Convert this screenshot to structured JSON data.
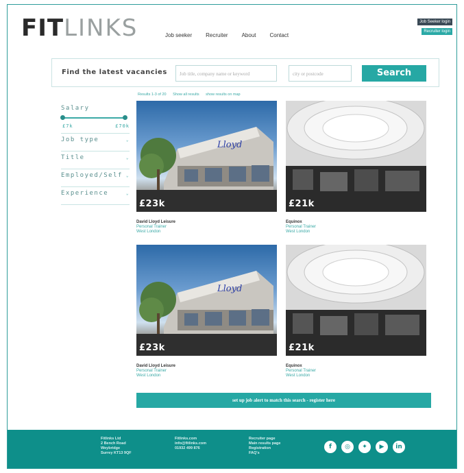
{
  "header": {
    "logo_bold": "FIT",
    "logo_light": "LINKS",
    "nav": [
      "Job seeker",
      "Recruiter",
      "About",
      "Contact"
    ],
    "login_seeker": "Job Seeker login",
    "login_recruiter": "Recruiter login"
  },
  "search": {
    "label": "Find the latest vacancies",
    "keyword_placeholder": "Job title, company name or keyword",
    "location_placeholder": "city or postcode",
    "button": "Search"
  },
  "results": {
    "count": "Results 1-3 of 20",
    "show_all": "Show all results",
    "show_map": "show results on map"
  },
  "filters": {
    "salary_label": "Salary",
    "salary_min": "£7k",
    "salary_max": "£70k",
    "salary_range_fraction": [
      0.0,
      1.0
    ],
    "items": [
      "Job type",
      "Title",
      "Employed/Self",
      "Experience"
    ]
  },
  "jobs": [
    {
      "salary": "£23k",
      "company": "David Lloyd Leisure",
      "role": "Personal Trainer",
      "location": "West London",
      "image": "building-illustration"
    },
    {
      "salary": "£21k",
      "company": "Equinox",
      "role": "Personal Trainer",
      "location": "West London",
      "image": "gym-interior-bw"
    },
    {
      "salary": "£23k",
      "company": "David Lloyd Leisure",
      "role": "Personal Trainer",
      "location": "West London",
      "image": "building-illustration"
    },
    {
      "salary": "£21k",
      "company": "Equinox",
      "role": "Personal Trainer",
      "location": "West London",
      "image": "gym-interior-bw"
    }
  ],
  "alert": "set up job alert to match this search - register here",
  "footer": {
    "address": [
      "Fitlinks Ltd",
      "2 Bench Road",
      "Weybridge",
      "Surrey KT13 9QF"
    ],
    "contact": [
      "Fitlinks.com",
      "info@fitlinks.com",
      "01932 499 876"
    ],
    "links": [
      "Recruiter page",
      "Main results page",
      "Registration",
      "FAQ's"
    ],
    "socials": [
      {
        "icon": "facebook-icon",
        "glyph": "f"
      },
      {
        "icon": "instagram-icon",
        "glyph": "◎"
      },
      {
        "icon": "twitter-icon",
        "glyph": "✦"
      },
      {
        "icon": "youtube-icon",
        "glyph": "▶"
      },
      {
        "icon": "linkedin-icon",
        "glyph": "in"
      }
    ]
  },
  "colors": {
    "accent": "#26a8a4",
    "footer": "#0e8f8a",
    "dark": "#3b4a56"
  }
}
